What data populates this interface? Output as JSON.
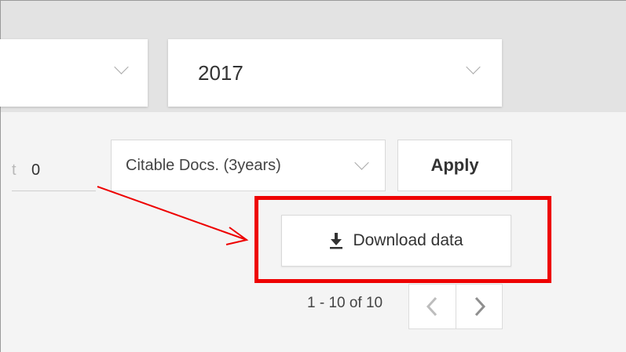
{
  "filters": {
    "year": "2017",
    "threshold_label": "t",
    "threshold_value": "0",
    "sort_by": "Citable Docs. (3years)",
    "apply_label": "Apply"
  },
  "download": {
    "label": "Download data"
  },
  "pagination": {
    "range_text": "1 - 10 of 10"
  },
  "annotation": {
    "highlight_color": "#ee0000"
  }
}
